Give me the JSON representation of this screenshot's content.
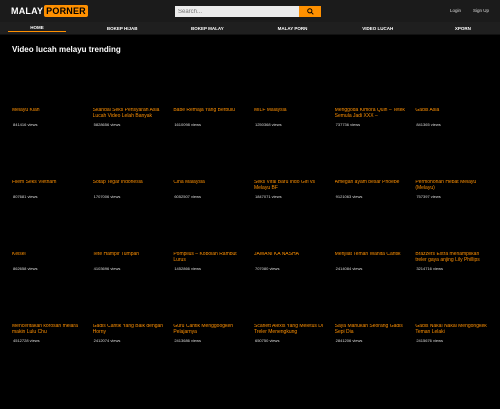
{
  "header": {
    "logo_part1": "MALAY",
    "logo_part2": "PORNER",
    "search_placeholder": "Search...",
    "login": "Login",
    "signup": "Sign Up"
  },
  "nav": [
    {
      "label": "HOME"
    },
    {
      "label": "BOKEP HIJAB"
    },
    {
      "label": "BOKEP MALAY"
    },
    {
      "label": "MALAY PORN"
    },
    {
      "label": "VIDEO LUCAH"
    },
    {
      "label": "XPORN"
    }
  ],
  "section_title": "Video lucah melayu trending",
  "videos": [
    {
      "title": "Melayu Kiah",
      "views": "841416 views"
    },
    {
      "title": "Skandal Seks Pensyarah Asia Lucah Video Lelah Banyak",
      "views": "5828656 views"
    },
    {
      "title": "Babe Remaja Yang Berbulu",
      "views": "1610098 views"
    },
    {
      "title": "MILF Malaysia",
      "views": "1250368 views"
    },
    {
      "title": "Menggoda Kimora Quin – Tetek Semula Jadi XXX –",
      "views": "737736 views"
    },
    {
      "title": "Gadis Asia",
      "views": "841365 views"
    },
    {
      "title": "Filem Seks Vietnam",
      "views": "807681 views"
    },
    {
      "title": "Sotap Tegar Indonesia",
      "views": "1707006 views"
    },
    {
      "title": "Cina Malaysia",
      "views": "6052507 views"
    },
    {
      "title": "Seks Viral Baru Indo Girl vs Melayu BF",
      "views": "1847071 views"
    },
    {
      "title": "Amegan ayam besar Phoebe",
      "views": "9121063 views"
    },
    {
      "title": "Permohonan Hebat Melayu (Melayu)",
      "views": "757397 views"
    },
    {
      "title": "Kelsei",
      "views": "862658 views"
    },
    {
      "title": "Tete Hampir Tumpah",
      "views": "4103696 views"
    },
    {
      "title": "Pompilus – Koboian Rambut Lurus",
      "views": "1452866 views"
    },
    {
      "title": "JAWANI KA NASHA",
      "views": "707080 views"
    },
    {
      "title": "Menjilat Teman Wanita Cantik",
      "views": "2414084 views"
    },
    {
      "title": "Brazzers Extra menampilkan treler gaya anjing Lily Phillips",
      "views": "3214716 views"
    },
    {
      "title": "Menceritakan korosan melara makin Lulu Chu",
      "views": "4512728 views"
    },
    {
      "title": "Gadis Cantik Yang Baik dengan Horny",
      "views": "2412074 views"
    },
    {
      "title": "Guru Cantik Menggoogkeh Pelajarnya",
      "views": "2413686 views"
    },
    {
      "title": "Scarlett Alexis Yang Meletus Di Treler Menengkung",
      "views": "650750 views"
    },
    {
      "title": "Saya Mahukan Seorang Gadis Sepi Dia",
      "views": "2841206 views"
    },
    {
      "title": "Gadis Nakal Nakal Mengongkek Teman Lelaki",
      "views": "2415676 views"
    }
  ]
}
